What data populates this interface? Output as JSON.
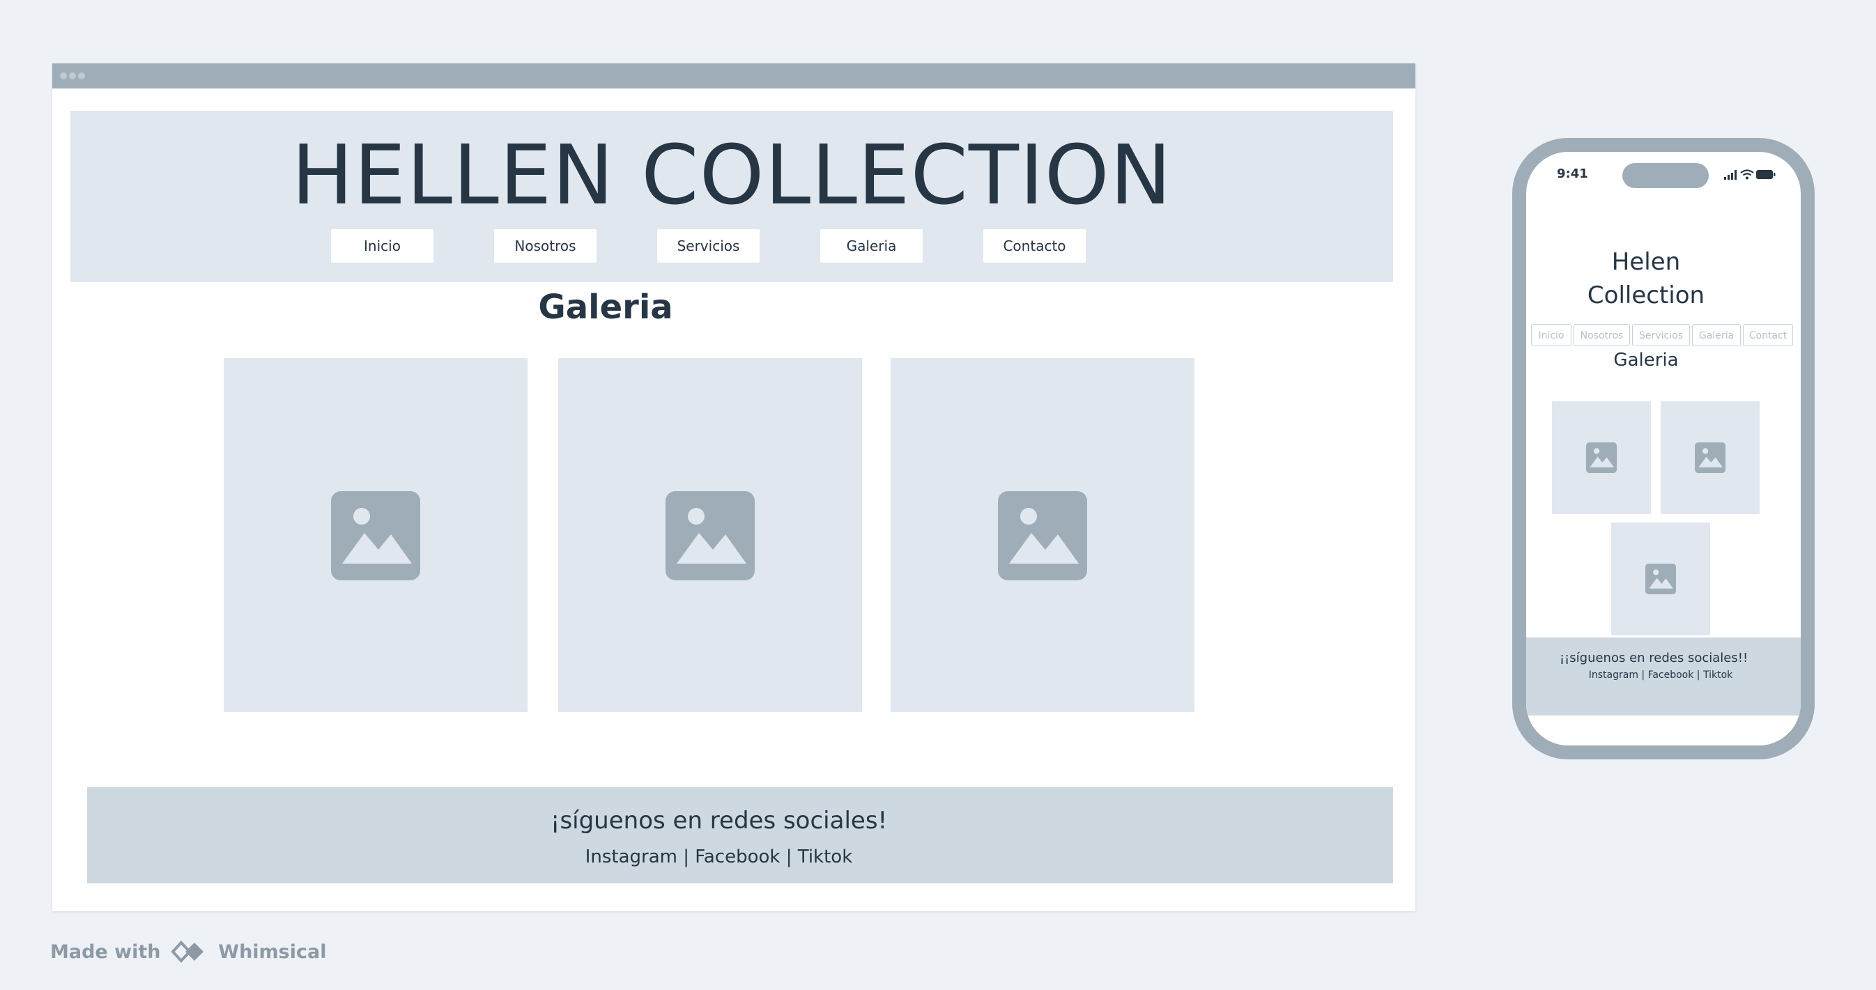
{
  "desktop": {
    "site_title": "HELLEN COLLECTION",
    "nav": [
      "Inicio",
      "Nosotros",
      "Servicios",
      "Galeria",
      "Contacto"
    ],
    "gallery_heading": "Galeria",
    "gallery_icon": "image-placeholder-icon",
    "footer": {
      "heading": "¡síguenos en redes sociales!",
      "links": "Instagram | Facebook | Tiktok"
    }
  },
  "mobile": {
    "status_time": "9:41",
    "site_title_line1": "Helen",
    "site_title_line2": "Collection",
    "nav": [
      "Inicio",
      "Nosotros",
      "Servicios",
      "Galeria",
      "Contact"
    ],
    "gallery_heading": "Galeria",
    "footer": {
      "heading": "¡¡síguenos en redes sociales!!",
      "links": "Instagram | Facebook | Tiktok"
    }
  },
  "watermark": {
    "prefix": "Made with",
    "brand": "Whimsical"
  },
  "colors": {
    "background": "#eef2f6",
    "frame": "#9fadb9",
    "panel": "#e1e7ef",
    "footer": "#cdd8e1",
    "text": "#263645"
  }
}
